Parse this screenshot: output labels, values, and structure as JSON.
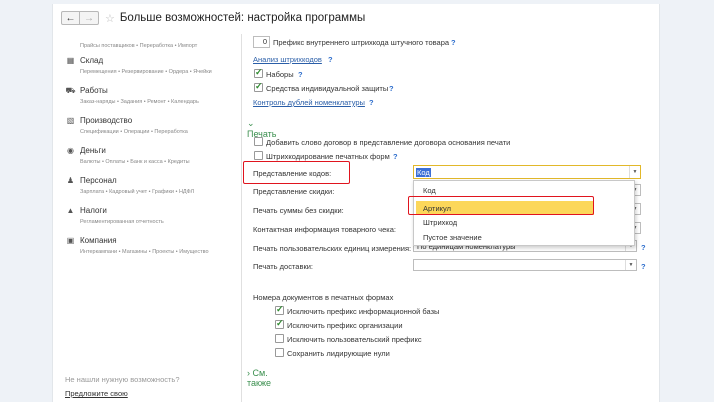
{
  "window": {
    "title": "Больше возможностей: настройка программы"
  },
  "sidebar": {
    "top_sub": "Прайсы поставщиков • Переработка • Импорт",
    "sections": [
      {
        "label": "Склад",
        "icon": "warehouse-icon",
        "sub": "Перемещения • Резервирование • Ордера • Ячейки"
      },
      {
        "label": "Работы",
        "icon": "truck-icon",
        "sub": "Заказ-наряды • Задания • Ремонт • Календарь"
      },
      {
        "label": "Производство",
        "icon": "factory-icon",
        "sub": "Спецификации • Операции • Переработка"
      },
      {
        "label": "Деньги",
        "icon": "money-icon",
        "sub": "Валюты • Оплаты • Банк и касса • Кредиты"
      },
      {
        "label": "Персонал",
        "icon": "person-icon",
        "sub": "Зарплата • Кадровый учет • Графики • НДФЛ"
      },
      {
        "label": "Налоги",
        "icon": "taxes-icon",
        "sub": "Регламентированная отчетность"
      },
      {
        "label": "Компания",
        "icon": "building-icon",
        "sub": "Интеркампани • Магазины • Проекты • Имущество"
      }
    ],
    "help_question": "Не нашли нужную возможность?",
    "help_link": "Предложите свою"
  },
  "settings": {
    "prefix_value": "0",
    "prefix_label": "Префикс внутреннего штрихкода штучного товара",
    "barcode_analysis": "Анализ штрихкодов",
    "kits_label": "Наборы",
    "ppe_label": "Средства индивидуальной защиты",
    "dup_control": "Контроль дублей номенклатуры",
    "print_section": "Печать",
    "add_contract_word": "Добавить слово договор в представление договора основания печати",
    "barcode_print": "Штрихкодирование печатных форм",
    "codes_repr_label": "Представление кодов:",
    "codes_repr_value": "Код",
    "discount_repr_label": "Представление скидки:",
    "print_sum_no_discount": "Печать суммы без скидки:",
    "receipt_contact": "Контактная информация товарного чека:",
    "print_user_units": "Печать пользовательских единиц измерения:",
    "user_units_value": "По единицам номенклатуры",
    "print_delivery": "Печать доставки:",
    "doc_numbers_title": "Номера документов в печатных формах",
    "exclude_ib_prefix": "Исключить префикс информационной базы",
    "exclude_org_prefix": "Исключить префикс организации",
    "exclude_user_prefix": "Исключить пользовательский префикс",
    "keep_leading_zeros": "Сохранить лидирующие нули",
    "see_also": "См. также"
  },
  "dropdown": {
    "options": [
      "Код",
      "Артикул",
      "Штрихкод",
      "Пустое значение"
    ],
    "selected_index": 1
  },
  "colors": {
    "accent_green": "#3a8f4e",
    "highlight": "#fcd75a",
    "annotation_red": "#e0141e",
    "link_blue": "#2a5ea8"
  }
}
